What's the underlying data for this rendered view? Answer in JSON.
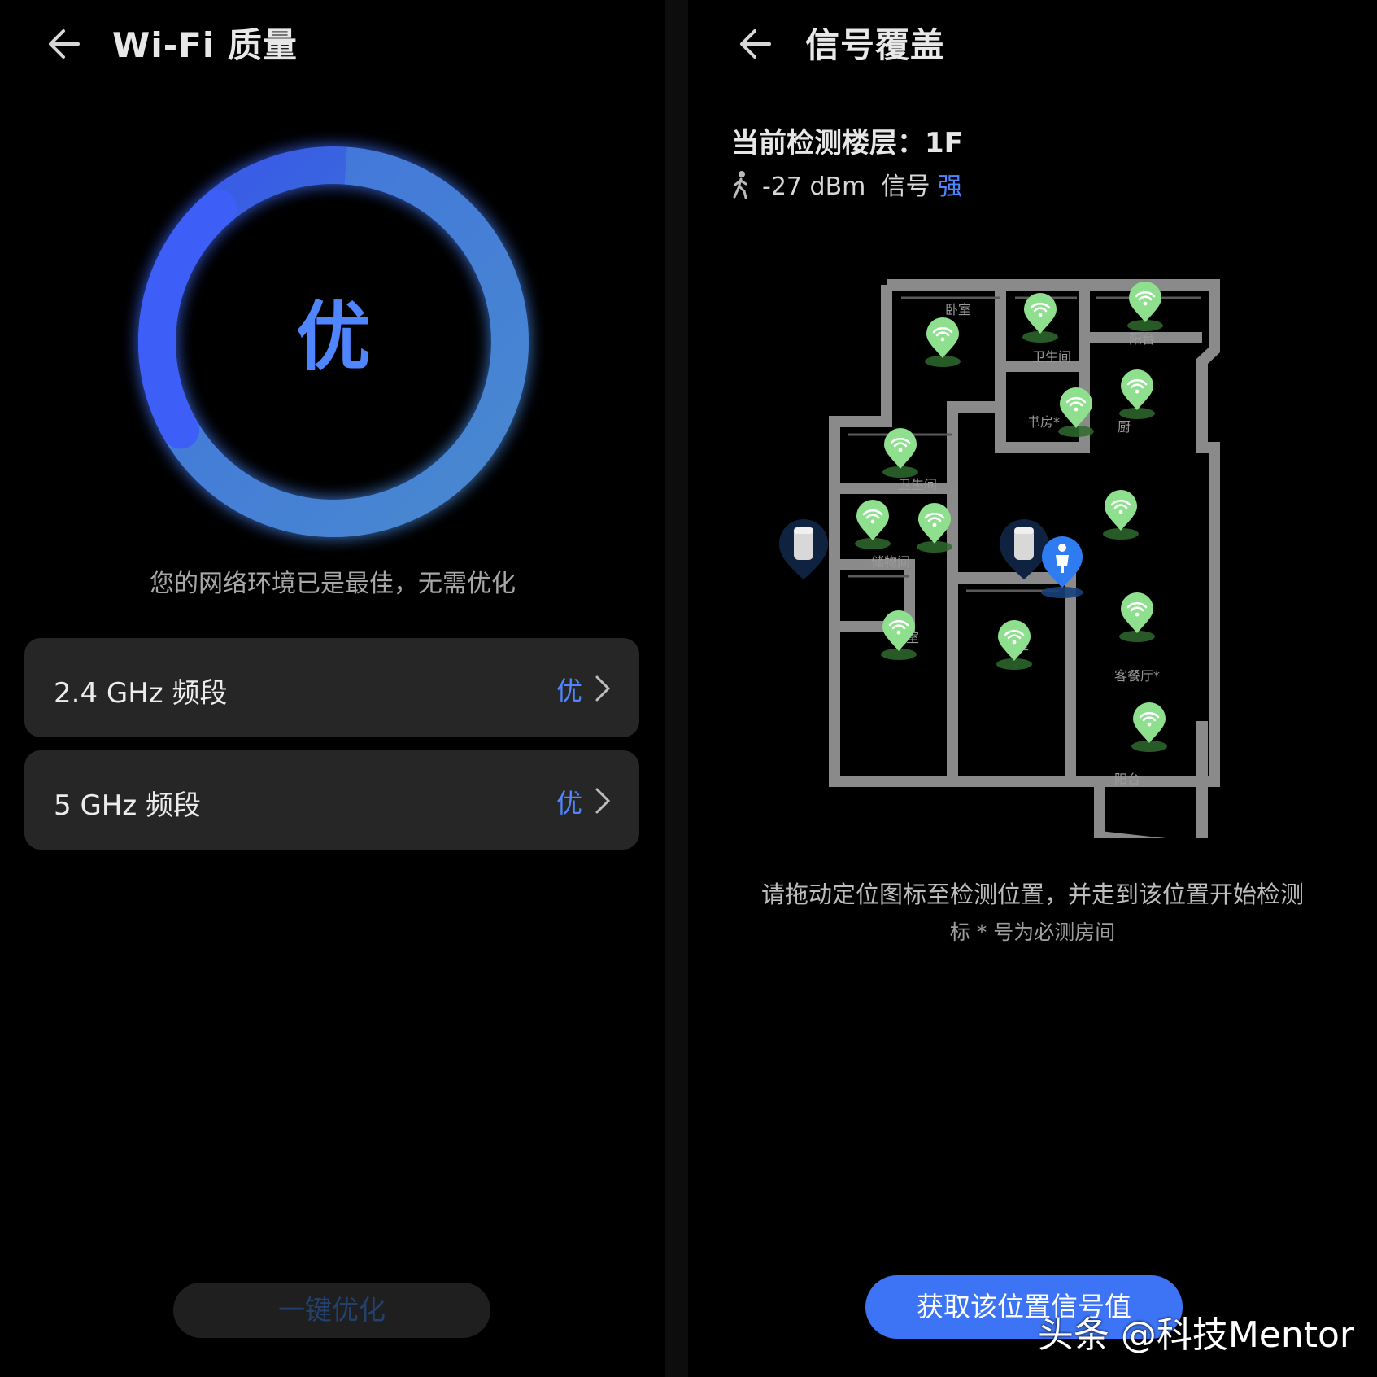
{
  "left": {
    "title": "Wi-Fi 质量",
    "ring_grade": "优",
    "message": "您的网络环境已是最佳，无需优化",
    "bands": [
      {
        "label": "2.4 GHz 频段",
        "grade": "优"
      },
      {
        "label": "5 GHz 频段",
        "grade": "优"
      }
    ],
    "optimize_button": "一键优化"
  },
  "right": {
    "title": "信号覆盖",
    "floor_line": "当前检测楼层：1F",
    "signal_value": "-27 dBm",
    "signal_label": "信号",
    "signal_level": "强",
    "rooms": {
      "bedroom_top": "卧室",
      "bathroom_top": "卫生间",
      "balcony_top": "阳台",
      "study": "书房*",
      "kitchen": "厨",
      "bathroom_mid": "卫生间",
      "storage": "储物间",
      "bedroom_left": "卧室",
      "bedroom_mid": "卧室",
      "living": "客餐厅*",
      "balcony_bottom": "阳台"
    },
    "hint_line1": "请拖动定位图标至检测位置，并走到该位置开始检测",
    "hint_line2": "标 * 号为必测房间",
    "get_button": "获取该位置信号值"
  },
  "watermark": "头条 @科技Mentor",
  "colors": {
    "accent": "#4f86ff",
    "ring_start": "#3a5cf5",
    "ring_end": "#4a8fd8",
    "button_blue": "#3d74f5",
    "signal_pin": "#8ee08e",
    "wall": "#8a8a8a"
  }
}
